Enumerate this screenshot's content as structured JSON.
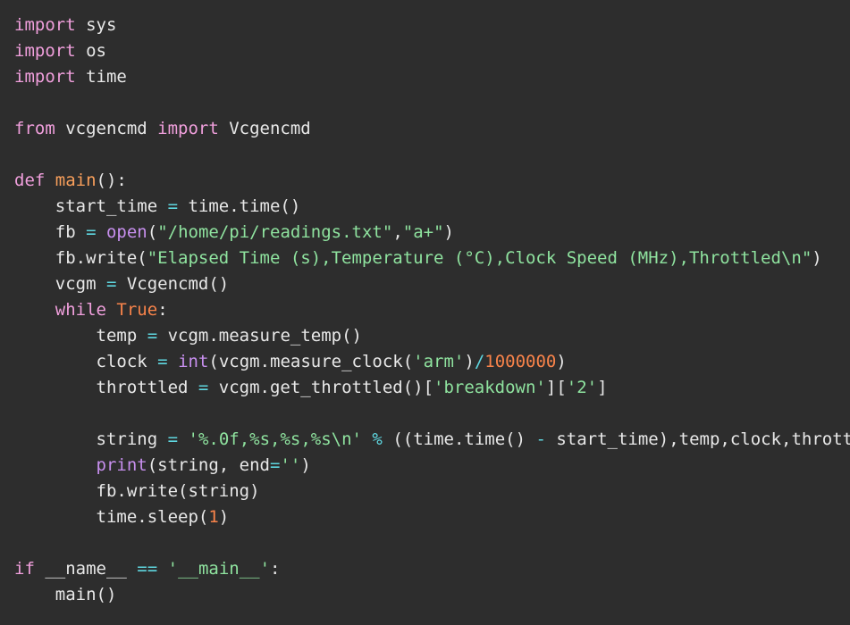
{
  "editor": {
    "kind": "code-viewer",
    "language": "Python",
    "background_color": "#2d2d2d",
    "default_text_color": "#e8e8e8",
    "theme_colors": {
      "keyword": "#f09fdc",
      "function_def": "#f89f5b",
      "builtin": "#c78fee",
      "string": "#8fe39f",
      "number": "#f8834a",
      "constant": "#f8834a",
      "operator": "#5fd7e0",
      "identifier": "#e8e8e8"
    }
  },
  "code": {
    "lines": [
      {
        "id": 1,
        "tokens": [
          {
            "text": "import",
            "type": "kw"
          },
          {
            "text": " sys",
            "type": "plain"
          }
        ]
      },
      {
        "id": 2,
        "tokens": [
          {
            "text": "import",
            "type": "kw"
          },
          {
            "text": " os",
            "type": "plain"
          }
        ]
      },
      {
        "id": 3,
        "tokens": [
          {
            "text": "import",
            "type": "kw"
          },
          {
            "text": " time",
            "type": "plain"
          }
        ]
      },
      {
        "id": 4,
        "tokens": []
      },
      {
        "id": 5,
        "tokens": [
          {
            "text": "from",
            "type": "kw"
          },
          {
            "text": " vcgencmd ",
            "type": "plain"
          },
          {
            "text": "import",
            "type": "kw"
          },
          {
            "text": " Vcgencmd",
            "type": "plain"
          }
        ]
      },
      {
        "id": 6,
        "tokens": []
      },
      {
        "id": 7,
        "tokens": [
          {
            "text": "def",
            "type": "kw"
          },
          {
            "text": " ",
            "type": "plain"
          },
          {
            "text": "main",
            "type": "fn"
          },
          {
            "text": "():",
            "type": "plain"
          }
        ]
      },
      {
        "id": 8,
        "tokens": [
          {
            "text": "    start_time ",
            "type": "plain"
          },
          {
            "text": "=",
            "type": "op"
          },
          {
            "text": " time.time()",
            "type": "plain"
          }
        ]
      },
      {
        "id": 9,
        "tokens": [
          {
            "text": "    fb ",
            "type": "plain"
          },
          {
            "text": "=",
            "type": "op"
          },
          {
            "text": " ",
            "type": "plain"
          },
          {
            "text": "open",
            "type": "bi"
          },
          {
            "text": "(",
            "type": "plain"
          },
          {
            "text": "\"/home/pi/readings.txt\"",
            "type": "str"
          },
          {
            "text": ",",
            "type": "plain"
          },
          {
            "text": "\"a+\"",
            "type": "str"
          },
          {
            "text": ")",
            "type": "plain"
          }
        ]
      },
      {
        "id": 10,
        "tokens": [
          {
            "text": "    fb.write(",
            "type": "plain"
          },
          {
            "text": "\"Elapsed Time (s),Temperature (°C),Clock Speed (MHz),Throttled\\n\"",
            "type": "str"
          },
          {
            "text": ")",
            "type": "plain"
          }
        ]
      },
      {
        "id": 11,
        "tokens": [
          {
            "text": "    vcgm ",
            "type": "plain"
          },
          {
            "text": "=",
            "type": "op"
          },
          {
            "text": " Vcgencmd()",
            "type": "plain"
          }
        ]
      },
      {
        "id": 12,
        "tokens": [
          {
            "text": "    ",
            "type": "plain"
          },
          {
            "text": "while",
            "type": "kw"
          },
          {
            "text": " ",
            "type": "plain"
          },
          {
            "text": "True",
            "type": "const"
          },
          {
            "text": ":",
            "type": "plain"
          }
        ]
      },
      {
        "id": 13,
        "tokens": [
          {
            "text": "        temp ",
            "type": "plain"
          },
          {
            "text": "=",
            "type": "op"
          },
          {
            "text": " vcgm.measure_temp()",
            "type": "plain"
          }
        ]
      },
      {
        "id": 14,
        "tokens": [
          {
            "text": "        clock ",
            "type": "plain"
          },
          {
            "text": "=",
            "type": "op"
          },
          {
            "text": " ",
            "type": "plain"
          },
          {
            "text": "int",
            "type": "bi"
          },
          {
            "text": "(vcgm.measure_clock(",
            "type": "plain"
          },
          {
            "text": "'arm'",
            "type": "str"
          },
          {
            "text": ")",
            "type": "plain"
          },
          {
            "text": "/",
            "type": "op"
          },
          {
            "text": "1000000",
            "type": "num"
          },
          {
            "text": ")",
            "type": "plain"
          }
        ]
      },
      {
        "id": 15,
        "tokens": [
          {
            "text": "        throttled ",
            "type": "plain"
          },
          {
            "text": "=",
            "type": "op"
          },
          {
            "text": " vcgm.get_throttled()[",
            "type": "plain"
          },
          {
            "text": "'breakdown'",
            "type": "str"
          },
          {
            "text": "][",
            "type": "plain"
          },
          {
            "text": "'2'",
            "type": "str"
          },
          {
            "text": "]",
            "type": "plain"
          }
        ]
      },
      {
        "id": 16,
        "tokens": []
      },
      {
        "id": 17,
        "tokens": [
          {
            "text": "        string ",
            "type": "plain"
          },
          {
            "text": "=",
            "type": "op"
          },
          {
            "text": " ",
            "type": "plain"
          },
          {
            "text": "'%.0f,%s,%s,%s\\n'",
            "type": "str"
          },
          {
            "text": " ",
            "type": "plain"
          },
          {
            "text": "%",
            "type": "op"
          },
          {
            "text": " ((time.time() ",
            "type": "plain"
          },
          {
            "text": "-",
            "type": "op"
          },
          {
            "text": " start_time),temp,clock,throttled)",
            "type": "plain"
          }
        ]
      },
      {
        "id": 18,
        "tokens": [
          {
            "text": "        ",
            "type": "plain"
          },
          {
            "text": "print",
            "type": "bi"
          },
          {
            "text": "(string, end",
            "type": "plain"
          },
          {
            "text": "=",
            "type": "op"
          },
          {
            "text": "''",
            "type": "str"
          },
          {
            "text": ")",
            "type": "plain"
          }
        ]
      },
      {
        "id": 19,
        "tokens": [
          {
            "text": "        fb.write(string)",
            "type": "plain"
          }
        ]
      },
      {
        "id": 20,
        "tokens": [
          {
            "text": "        time.sleep(",
            "type": "plain"
          },
          {
            "text": "1",
            "type": "num"
          },
          {
            "text": ")",
            "type": "plain"
          }
        ]
      },
      {
        "id": 21,
        "tokens": []
      },
      {
        "id": 22,
        "tokens": [
          {
            "text": "if",
            "type": "kw"
          },
          {
            "text": " __name__ ",
            "type": "plain"
          },
          {
            "text": "==",
            "type": "op"
          },
          {
            "text": " ",
            "type": "plain"
          },
          {
            "text": "'__main__'",
            "type": "str"
          },
          {
            "text": ":",
            "type": "plain"
          }
        ]
      },
      {
        "id": 23,
        "tokens": [
          {
            "text": "    main()",
            "type": "plain"
          }
        ]
      }
    ]
  }
}
